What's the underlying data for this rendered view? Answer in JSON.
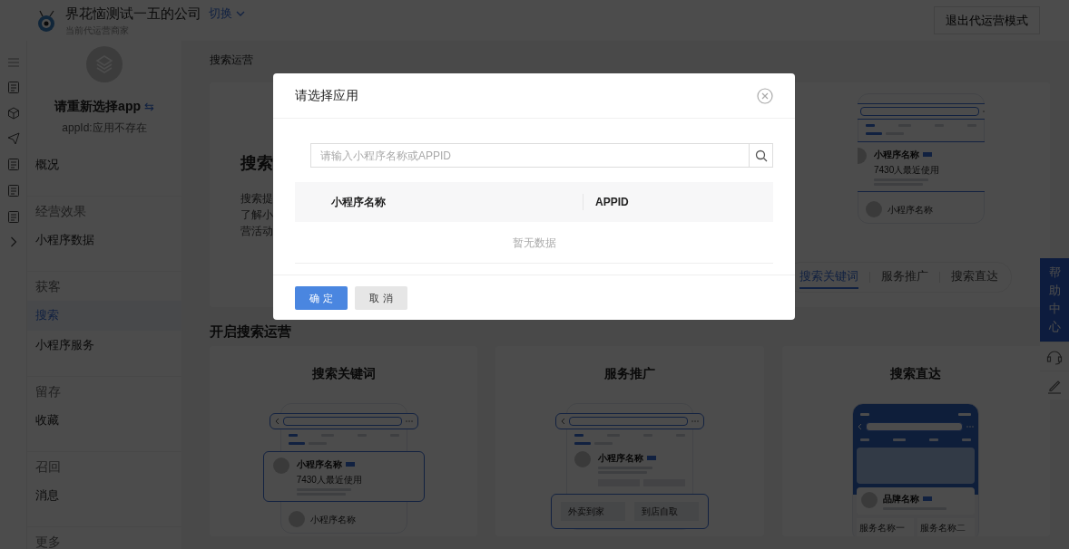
{
  "header": {
    "company": "界花恼测试一五的公司",
    "switch_link": "切换",
    "subtitle": "当前代运营商家",
    "exit_button": "退出代运营模式"
  },
  "sidebar": {
    "app_title": "请重新选择app",
    "swap_icon": "⇆",
    "app_id": "appId:应用不存在",
    "items": [
      {
        "kind": "item",
        "label": "概况",
        "selected": false
      },
      {
        "kind": "group",
        "label": "经营效果"
      },
      {
        "kind": "item",
        "label": "小程序数据",
        "selected": false
      },
      {
        "kind": "group",
        "label": "获客"
      },
      {
        "kind": "item",
        "label": "搜索",
        "selected": true
      },
      {
        "kind": "item",
        "label": "小程序服务",
        "selected": false
      },
      {
        "kind": "group",
        "label": "留存"
      },
      {
        "kind": "item",
        "label": "收藏",
        "selected": false
      },
      {
        "kind": "group",
        "label": "召回"
      },
      {
        "kind": "item",
        "label": "消息",
        "selected": false
      },
      {
        "kind": "group",
        "label": "更多"
      }
    ]
  },
  "page_title": "搜索运营",
  "banner": {
    "title": "搜索",
    "lines": [
      "搜索提",
      "了解小",
      "营活动"
    ],
    "mockup": {
      "kind": "keyword",
      "card": {
        "title": "小程序名称",
        "lines": [
          "7430人最近使用"
        ]
      },
      "next_item": "小程序名称"
    },
    "tabs": [
      {
        "label": "搜索关键词",
        "selected": true
      },
      {
        "label": "服务推广",
        "selected": false
      },
      {
        "label": "搜索直达",
        "selected": false
      }
    ]
  },
  "section_title": "开启搜索运营",
  "cards": [
    {
      "title": "搜索关键词",
      "mockup": {
        "kind": "keyword",
        "card": {
          "title": "小程序名称",
          "lines": [
            "7430人最近使用"
          ]
        },
        "next_item": "小程序名称"
      }
    },
    {
      "title": "服务推广",
      "mockup": {
        "kind": "service",
        "card": {
          "title": "小程序名称"
        },
        "popup": [
          "外卖到家",
          "到店自取"
        ]
      }
    },
    {
      "title": "搜索直达",
      "mockup": {
        "kind": "direct",
        "brand": {
          "title": "品牌名称"
        },
        "services": [
          "服务名称一",
          "服务名称二"
        ]
      }
    }
  ],
  "help": {
    "label": "帮助中心"
  },
  "dialog": {
    "title": "请选择应用",
    "search": {
      "placeholder": "请输入小程序名称或APPID"
    },
    "columns": [
      "小程序名称",
      "APPID"
    ],
    "empty": "暂无数据",
    "buttons": [
      {
        "label": "确 定",
        "kind": "primary"
      },
      {
        "label": "取 消",
        "kind": "secondary"
      }
    ]
  }
}
